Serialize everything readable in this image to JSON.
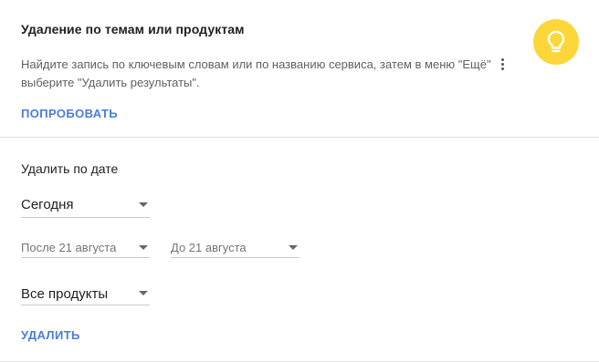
{
  "topics_section": {
    "title": "Удаление по темам или продуктам",
    "description_part1": "Найдите запись по ключевым словам или по названию сервиса, затем в меню \"Ещё\"",
    "description_part2": "выберите \"Удалить результаты\".",
    "try_button": "ПОПРОБОВАТЬ",
    "bulb_icon": "lightbulb-icon",
    "bulb_color": "#fdd63a"
  },
  "date_section": {
    "title": "Удалить по дате",
    "period_select": {
      "selected": "Сегодня"
    },
    "after_select": {
      "selected": "После 21 августа"
    },
    "before_select": {
      "selected": "До 21 августа"
    },
    "products_select": {
      "selected": "Все продукты"
    },
    "delete_button": "УДАЛИТЬ"
  },
  "colors": {
    "accent": "#4a7dd6",
    "divider": "#e0e0e0"
  }
}
